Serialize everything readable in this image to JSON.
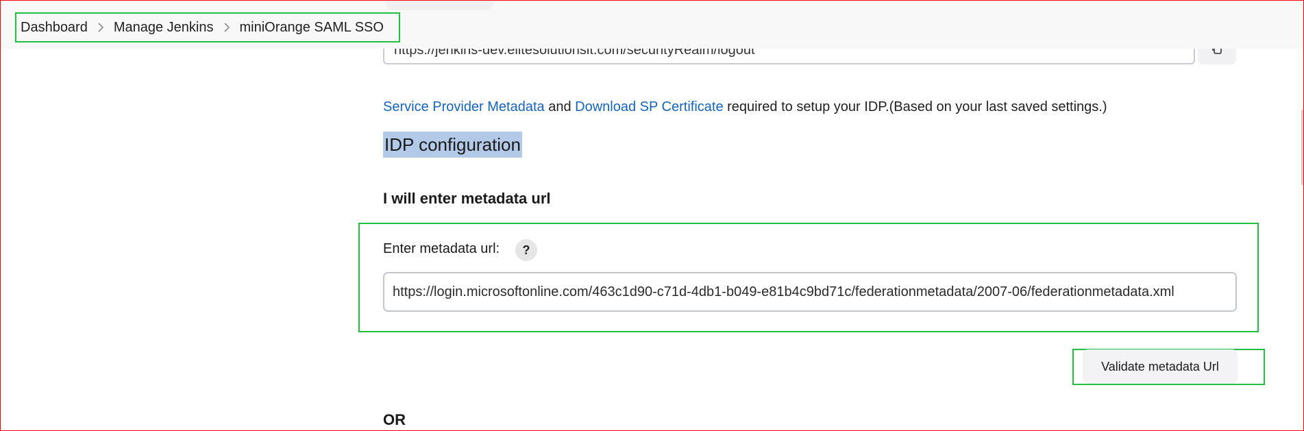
{
  "breadcrumb": {
    "items": [
      "Dashboard",
      "Manage Jenkins",
      "miniOrange SAML SSO"
    ]
  },
  "previous_field": {
    "value": "https://jenkins-dev.elitesolutionsit.com/securityRealm/logout"
  },
  "info": {
    "sp_metadata_link": "Service Provider Metadata",
    "and": "and",
    "sp_certificate_link": "Download SP Certificate",
    "suffix": "required to setup your IDP.(Based on your last saved settings.)"
  },
  "idp": {
    "title": "IDP configuration",
    "subheading": "I will enter metadata url",
    "metadata_label": "Enter metadata url:",
    "help_icon": "?",
    "metadata_url": "https://login.microsoftonline.com/463c1d90-c71d-4db1-b049-e81b4c9bd71c/federationmetadata/2007-06/federationmetadata.xml",
    "validate_button": "Validate metadata Url",
    "or_text": "OR"
  },
  "icons": {
    "breadcrumb_separator": "chevron-right-icon",
    "copy": "copy-icon",
    "help": "help-icon"
  },
  "colors": {
    "link": "#1465c0",
    "highlight": "#b3c9e8",
    "annotation_green": "#22c040",
    "annotation_red": "#ff0000"
  }
}
